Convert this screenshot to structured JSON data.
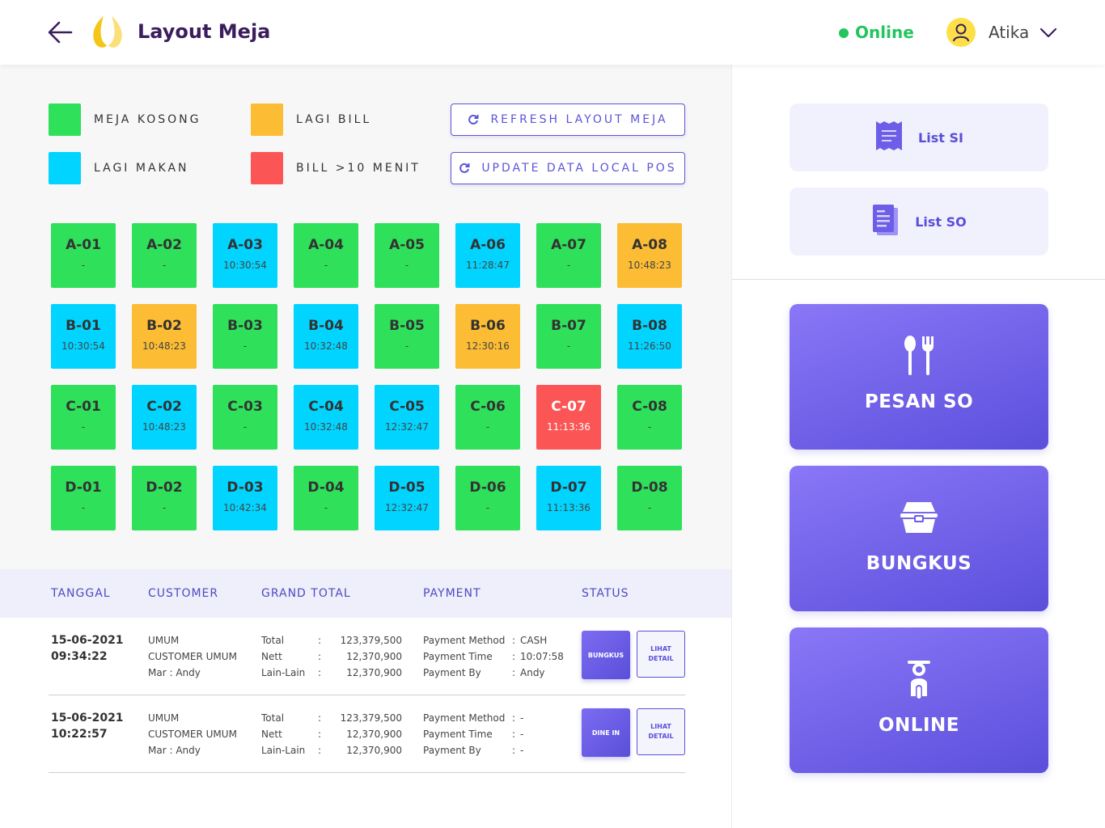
{
  "header": {
    "title": "Layout Meja",
    "status": "Online",
    "user_name": "Atika"
  },
  "legend": [
    {
      "label": "MEJA KOSONG",
      "color": "#2ee05a"
    },
    {
      "label": "LAGI MAKAN",
      "color": "#00d4ff"
    },
    {
      "label": "LAGI BILL",
      "color": "#fcbc33"
    },
    {
      "label": "BILL >10 MENIT",
      "color": "#fb5555"
    }
  ],
  "actions": {
    "refresh_label": "REFRESH LAYOUT MEJA",
    "update_label": "UPDATE DATA LOCAL POS"
  },
  "colors": {
    "kosong": "#2ee05a",
    "makan": "#00d4ff",
    "bill": "#fcbc33",
    "late": "#fb5555",
    "accent": "#5a4fd8"
  },
  "tables": [
    [
      {
        "id": "A-01",
        "time": "-",
        "status": "kosong"
      },
      {
        "id": "A-02",
        "time": "-",
        "status": "kosong"
      },
      {
        "id": "A-03",
        "time": "10:30:54",
        "status": "makan"
      },
      {
        "id": "A-04",
        "time": "-",
        "status": "kosong"
      },
      {
        "id": "A-05",
        "time": "-",
        "status": "kosong"
      },
      {
        "id": "A-06",
        "time": "11:28:47",
        "status": "makan"
      },
      {
        "id": "A-07",
        "time": "-",
        "status": "kosong"
      },
      {
        "id": "A-08",
        "time": "10:48:23",
        "status": "bill"
      }
    ],
    [
      {
        "id": "B-01",
        "time": "10:30:54",
        "status": "makan"
      },
      {
        "id": "B-02",
        "time": "10:48:23",
        "status": "bill"
      },
      {
        "id": "B-03",
        "time": "-",
        "status": "kosong"
      },
      {
        "id": "B-04",
        "time": "10:32:48",
        "status": "makan"
      },
      {
        "id": "B-05",
        "time": "-",
        "status": "kosong"
      },
      {
        "id": "B-06",
        "time": "12:30:16",
        "status": "bill"
      },
      {
        "id": "B-07",
        "time": "-",
        "status": "kosong"
      },
      {
        "id": "B-08",
        "time": "11:26:50",
        "status": "makan"
      }
    ],
    [
      {
        "id": "C-01",
        "time": "-",
        "status": "kosong"
      },
      {
        "id": "C-02",
        "time": "10:48:23",
        "status": "makan"
      },
      {
        "id": "C-03",
        "time": "-",
        "status": "kosong"
      },
      {
        "id": "C-04",
        "time": "10:32:48",
        "status": "makan"
      },
      {
        "id": "C-05",
        "time": "12:32:47",
        "status": "makan"
      },
      {
        "id": "C-06",
        "time": "-",
        "status": "kosong"
      },
      {
        "id": "C-07",
        "time": "11:13:36",
        "status": "late"
      },
      {
        "id": "C-08",
        "time": "-",
        "status": "kosong"
      }
    ],
    [
      {
        "id": "D-01",
        "time": "-",
        "status": "kosong"
      },
      {
        "id": "D-02",
        "time": "-",
        "status": "kosong"
      },
      {
        "id": "D-03",
        "time": "10:42:34",
        "status": "makan"
      },
      {
        "id": "D-04",
        "time": "-",
        "status": "kosong"
      },
      {
        "id": "D-05",
        "time": "12:32:47",
        "status": "makan"
      },
      {
        "id": "D-06",
        "time": "-",
        "status": "kosong"
      },
      {
        "id": "D-07",
        "time": "11:13:36",
        "status": "makan"
      },
      {
        "id": "D-08",
        "time": "-",
        "status": "kosong"
      }
    ]
  ],
  "transactions": {
    "columns": [
      "TANGGAL",
      "CUSTOMER",
      "GRAND TOTAL",
      "PAYMENT",
      "STATUS"
    ],
    "rows": [
      {
        "date": "15-06-2021",
        "time": "09:34:22",
        "customer": [
          "UMUM",
          "CUSTOMER UMUM",
          "Mar : Andy"
        ],
        "totals": [
          {
            "label": "Total",
            "value": "123,379,500"
          },
          {
            "label": "Nett",
            "value": "12,370,900"
          },
          {
            "label": "Lain-Lain",
            "value": "12,370,900"
          }
        ],
        "payment": [
          {
            "label": "Payment Method",
            "value": "CASH"
          },
          {
            "label": "Payment Time",
            "value": "10:07:58"
          },
          {
            "label": "Payment By",
            "value": "Andy"
          }
        ],
        "status": "BUNGKUS",
        "detail_label": "LIHAT DETAIL"
      },
      {
        "date": "15-06-2021",
        "time": "10:22:57",
        "customer": [
          "UMUM",
          "CUSTOMER UMUM",
          "Mar : Andy"
        ],
        "totals": [
          {
            "label": "Total",
            "value": "123,379,500"
          },
          {
            "label": "Nett",
            "value": "12,370,900"
          },
          {
            "label": "Lain-Lain",
            "value": "12,370,900"
          }
        ],
        "payment": [
          {
            "label": "Payment Method",
            "value": "-"
          },
          {
            "label": "Payment Time",
            "value": "-"
          },
          {
            "label": "Payment By",
            "value": "-"
          }
        ],
        "status": "DINE IN",
        "detail_label": "LIHAT DETAIL"
      }
    ]
  },
  "sidebar": {
    "list_si": "List SI",
    "list_so": "List SO",
    "pesan_so": "PESAN SO",
    "bungkus": "BUNGKUS",
    "online": "ONLINE"
  }
}
